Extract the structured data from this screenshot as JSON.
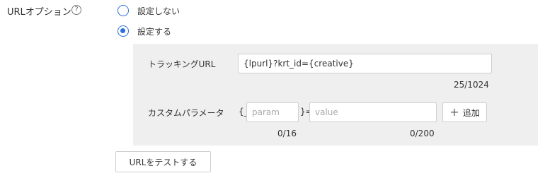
{
  "section": {
    "label": "URLオプション",
    "help_icon": "question-circle-icon"
  },
  "radios": [
    {
      "label": "設定しない",
      "checked": false
    },
    {
      "label": "設定する",
      "checked": true
    }
  ],
  "tracking": {
    "label": "トラッキングURL",
    "value": "{lpurl}?krt_id={creative}",
    "counter": "25/1024"
  },
  "custom_param": {
    "label": "カスタムパラメータ",
    "open_brace": "{_",
    "close_brace": "}=",
    "param_placeholder": "param",
    "value_placeholder": "value",
    "param_counter": "0/16",
    "value_counter": "0/200"
  },
  "add_button": {
    "icon": "plus-icon",
    "label": "追加"
  },
  "test_button": {
    "label": "URLをテストする"
  },
  "colors": {
    "accent": "#2a6fdb",
    "panel_bg": "#efefef",
    "border": "#cfcfcf"
  }
}
